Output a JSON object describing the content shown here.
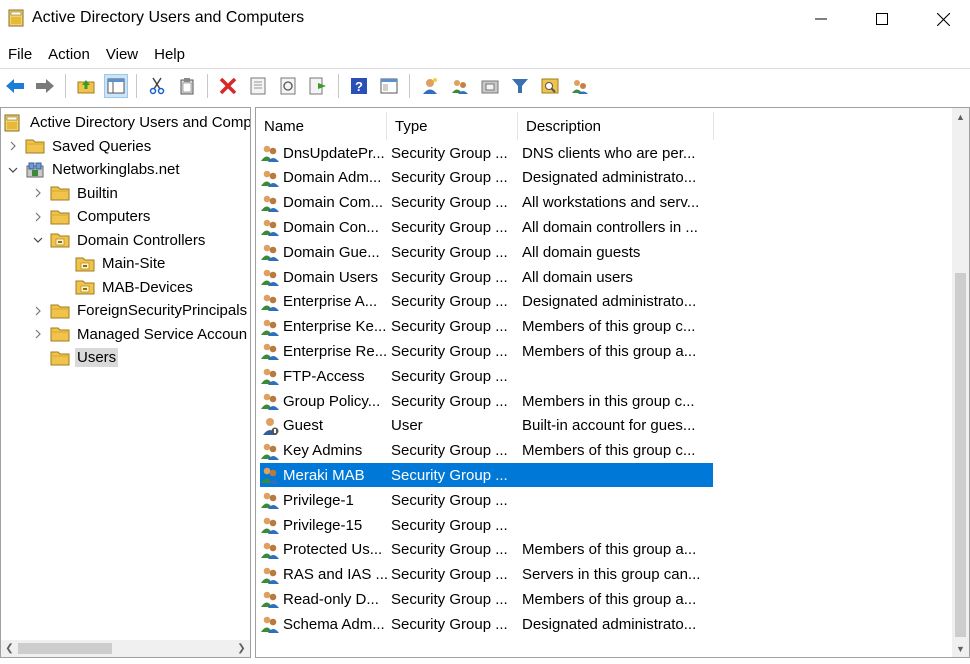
{
  "window": {
    "title": "Active Directory Users and Computers"
  },
  "menu": [
    "File",
    "Action",
    "View",
    "Help"
  ],
  "toolbar": {
    "icons": [
      "back-icon",
      "forward-icon",
      "up-folder-icon",
      "show-console-tree-icon",
      "cut-icon",
      "paste-icon",
      "delete-icon",
      "properties-icon",
      "refresh-icon",
      "export-list-icon",
      "help-icon",
      "console-icon",
      "new-user-icon",
      "new-group-icon",
      "new-ou-icon",
      "filter-icon",
      "find-icon",
      "add-to-group-icon"
    ]
  },
  "tree": [
    {
      "label": "Active Directory Users and Comp",
      "level": 0,
      "arrow": "none",
      "icon": "snapin-icon"
    },
    {
      "label": "Saved Queries",
      "level": 1,
      "arrow": "collapsed",
      "icon": "folder-icon"
    },
    {
      "label": "Networkinglabs.net",
      "level": 1,
      "arrow": "expanded",
      "icon": "domain-icon"
    },
    {
      "label": "Builtin",
      "level": 2,
      "arrow": "collapsed",
      "icon": "folder-icon"
    },
    {
      "label": "Computers",
      "level": 2,
      "arrow": "collapsed",
      "icon": "folder-icon"
    },
    {
      "label": "Domain Controllers",
      "level": 2,
      "arrow": "expanded",
      "icon": "ou-icon"
    },
    {
      "label": "Main-Site",
      "level": 3,
      "arrow": "none",
      "icon": "ou-icon"
    },
    {
      "label": "MAB-Devices",
      "level": 3,
      "arrow": "none",
      "icon": "ou-icon"
    },
    {
      "label": "ForeignSecurityPrincipals",
      "level": 2,
      "arrow": "collapsed",
      "icon": "folder-icon"
    },
    {
      "label": "Managed Service Accoun",
      "level": 2,
      "arrow": "collapsed",
      "icon": "folder-icon"
    },
    {
      "label": "Users",
      "level": 2,
      "arrow": "none",
      "icon": "folder-icon",
      "selected": true
    }
  ],
  "columns": [
    "Name",
    "Type",
    "Description"
  ],
  "rows": [
    {
      "name": "DnsUpdatePr...",
      "type": "Security Group ...",
      "desc": "DNS clients who are per..."
    },
    {
      "name": "Domain Adm...",
      "type": "Security Group ...",
      "desc": "Designated administrato..."
    },
    {
      "name": "Domain Com...",
      "type": "Security Group ...",
      "desc": "All workstations and serv..."
    },
    {
      "name": "Domain Con...",
      "type": "Security Group ...",
      "desc": "All domain controllers in ..."
    },
    {
      "name": "Domain Gue...",
      "type": "Security Group ...",
      "desc": "All domain guests"
    },
    {
      "name": "Domain Users",
      "type": "Security Group ...",
      "desc": "All domain users"
    },
    {
      "name": "Enterprise A...",
      "type": "Security Group ...",
      "desc": "Designated administrato..."
    },
    {
      "name": "Enterprise Ke...",
      "type": "Security Group ...",
      "desc": "Members of this group c..."
    },
    {
      "name": "Enterprise Re...",
      "type": "Security Group ...",
      "desc": "Members of this group a..."
    },
    {
      "name": "FTP-Access",
      "type": "Security Group ...",
      "desc": ""
    },
    {
      "name": "Group Policy...",
      "type": "Security Group ...",
      "desc": "Members in this group c..."
    },
    {
      "name": "Guest",
      "type": "User",
      "desc": "Built-in account for gues...",
      "icon": "user"
    },
    {
      "name": "Key Admins",
      "type": "Security Group ...",
      "desc": "Members of this group c..."
    },
    {
      "name": "Meraki MAB",
      "type": "Security Group ...",
      "desc": "",
      "selected": true
    },
    {
      "name": "Privilege-1",
      "type": "Security Group ...",
      "desc": ""
    },
    {
      "name": "Privilege-15",
      "type": "Security Group ...",
      "desc": ""
    },
    {
      "name": "Protected Us...",
      "type": "Security Group ...",
      "desc": "Members of this group a..."
    },
    {
      "name": "RAS and IAS ...",
      "type": "Security Group ...",
      "desc": "Servers in this group can..."
    },
    {
      "name": "Read-only D...",
      "type": "Security Group ...",
      "desc": "Members of this group a..."
    },
    {
      "name": "Schema Adm...",
      "type": "Security Group ...",
      "desc": "Designated administrato..."
    }
  ],
  "colors": {
    "selection": "#0078d7",
    "tree_selection": "#d9d9d9",
    "folder": "#f0c44c"
  }
}
